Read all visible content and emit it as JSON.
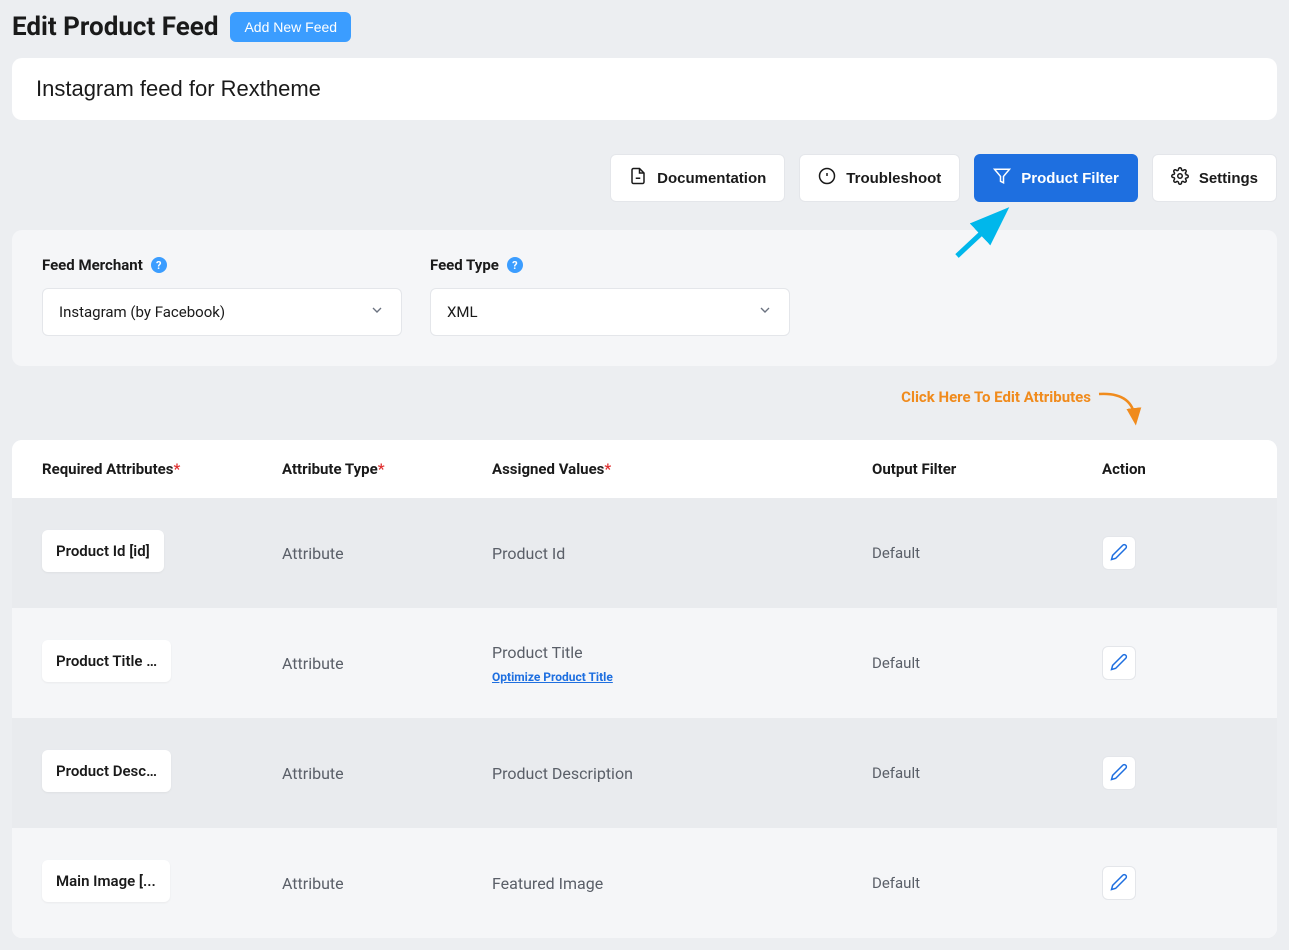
{
  "page": {
    "title": "Edit Product Feed",
    "add_feed_label": "Add New Feed",
    "feed_title": "Instagram feed for Rextheme"
  },
  "actions": {
    "documentation": "Documentation",
    "troubleshoot": "Troubleshoot",
    "product_filter": "Product Filter",
    "settings": "Settings"
  },
  "config": {
    "merchant_label": "Feed Merchant",
    "merchant_value": "Instagram (by Facebook)",
    "feed_type_label": "Feed Type",
    "feed_type_value": "XML"
  },
  "hint": {
    "edit_attributes": "Click Here To Edit Attributes"
  },
  "table": {
    "headers": {
      "required": "Required Attributes",
      "type": "Attribute Type",
      "assigned": "Assigned Values",
      "output": "Output Filter",
      "action": "Action"
    },
    "rows": [
      {
        "required": "Product Id [id]",
        "type": "Attribute",
        "assigned": "Product Id",
        "output": "Default",
        "optimize": ""
      },
      {
        "required": "Product Title …",
        "type": "Attribute",
        "assigned": "Product Title",
        "output": "Default",
        "optimize": "Optimize Product Title"
      },
      {
        "required": "Product Desc…",
        "type": "Attribute",
        "assigned": "Product Description",
        "output": "Default",
        "optimize": ""
      },
      {
        "required": "Main Image [...",
        "type": "Attribute",
        "assigned": "Featured Image",
        "output": "Default",
        "optimize": ""
      }
    ]
  }
}
